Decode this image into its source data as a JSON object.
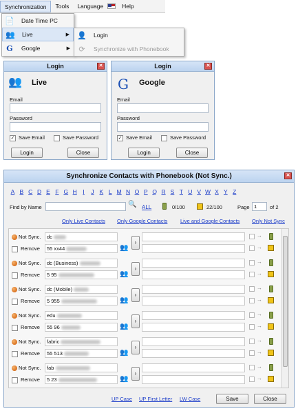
{
  "menu": {
    "items": [
      "Synchronization",
      "Tools",
      "Language",
      "Help"
    ]
  },
  "sync_menu": {
    "items": [
      {
        "label": "Date Time PC",
        "icon": "document-icon"
      },
      {
        "label": "Live",
        "icon": "live-messenger-icon"
      },
      {
        "label": "Google",
        "icon": "google-g-icon"
      }
    ]
  },
  "live_submenu": {
    "items": [
      {
        "label": "Login",
        "icon": "user-icon",
        "enabled": true
      },
      {
        "label": "Synchronize with Phonebook",
        "icon": "sync-icon",
        "enabled": false
      }
    ]
  },
  "login_live": {
    "title": "Login",
    "provider": "Live",
    "email_label": "Email",
    "password_label": "Password",
    "save_email": "Save Email",
    "save_password": "Save Password",
    "login_button": "Login",
    "close_button": "Close"
  },
  "login_google": {
    "title": "Login",
    "provider": "Google",
    "email_label": "Email",
    "password_label": "Password",
    "save_email": "Save Email",
    "save_password": "Save Password",
    "login_button": "Login",
    "close_button": "Close"
  },
  "sync_window": {
    "title": "Synchronize Contacts with Phonebook (Not Sync.)",
    "letters": [
      "A",
      "B",
      "C",
      "D",
      "E",
      "F",
      "G",
      "H",
      "I",
      "J",
      "K",
      "L",
      "M",
      "N",
      "O",
      "P",
      "Q",
      "R",
      "S",
      "T",
      "U",
      "V",
      "W",
      "X",
      "Y",
      "Z"
    ],
    "find_label": "Find by Name",
    "all_link": "ALL",
    "phone_count": "0/100",
    "book_count": "22/100",
    "page_label": "Page",
    "page_value": "1",
    "page_of": "of 2",
    "filters": [
      "Only Live Contacts",
      "Only Google Contacts",
      "Live and Google Contacts",
      "Only Not Sync"
    ],
    "status_text": "Not Sync.",
    "remove_text": "Remove",
    "rows": [
      {
        "name": "dc",
        "phone": "55 xx44"
      },
      {
        "name": "dc (Business)",
        "phone": "5 95"
      },
      {
        "name": "dc (Mobile)",
        "phone": "5 955"
      },
      {
        "name": "edu",
        "phone": "55 96"
      },
      {
        "name": "fabric",
        "phone": "55 513"
      },
      {
        "name": "fab",
        "phone": "5 23"
      }
    ],
    "case_links": [
      "UP Case",
      "UP First Letter",
      "LW Case"
    ],
    "save_button": "Save",
    "close_button": "Close"
  }
}
